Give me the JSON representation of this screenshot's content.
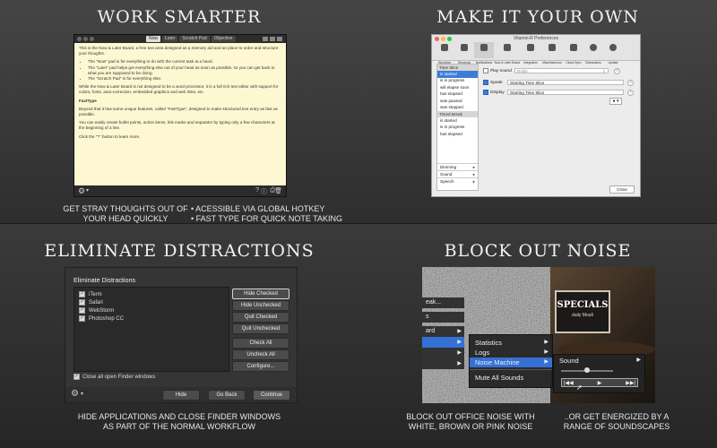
{
  "panels": {
    "work": {
      "heading": "WORK SMARTER",
      "caption_left": [
        "GET STRAY THOUGHTS OUT OF",
        "YOUR HEAD QUICKLY"
      ],
      "caption_right": [
        "• ACESSIBLE VIA GLOBAL HOTKEY",
        "• FAST TYPE FOR QUICK NOTE TAKING"
      ],
      "window": {
        "tabs": [
          "Now",
          "Later",
          "Scratch Pad",
          "Objective"
        ],
        "active_tab": "Now",
        "body": {
          "intro": "This is the Now & Later Board, a free text area designed as a memory aid and an place to order and structure your thoughts.",
          "bullets": [
            "The \"Now\" pad is for everything to do with the current task at a hand.",
            "The \"Later\" pad helps get everything else out of your head as soon as possible, so you can get back to what you are supposed to be doing.",
            "The \"Scratch Pad\" is for everything else."
          ],
          "para2": "While the Now & Later Board is not designed to be a word processor, it is a full rich text editor with support for colors, fonts, auto-correction, embedded graphics and web links, etc.",
          "heading2": "FastType",
          "para3": "Beyond that it has some unique features, called \"FastType\", designed to make structured text entry as fast as possible.",
          "para4": "You can easily create bullet points, action items, link marks and separator by typing only a few characters at the beginning of a line.",
          "para5": "Click the \"?\" button to learn more."
        }
      }
    },
    "own": {
      "heading": "MAKE IT YOUR OWN",
      "window": {
        "title": "Vitamin-R Preferences",
        "toolbar": [
          "Workflow",
          "Shortcuts",
          "Notifications",
          "Now & Later Board",
          "Integration",
          "Miscellaneous",
          "Cloud Sync",
          "Distractions",
          "Update"
        ],
        "selected_tool": "Notifications",
        "groups": [
          {
            "title": "Time Slice",
            "items": [
              "is started",
              "is in progress",
              "will elapse soon",
              "has elapsed",
              "was paused",
              "was stopped"
            ]
          },
          {
            "title": "Timed Break",
            "items": [
              "is started",
              "is in progress",
              "has elapsed"
            ]
          }
        ],
        "selected_item": "is started",
        "categories": [
          "Dimming",
          "Sound",
          "Speech"
        ],
        "play_sound_label": "Play sound",
        "play_sound_value": "Bottle",
        "speak_label": "Speak",
        "speak_value": "Starting Time Slice",
        "display_label": "Display",
        "display_value": "Starting Time Slice",
        "help": "?",
        "close_button": "Close"
      }
    },
    "distractions": {
      "heading": "ELIMINATE DISTRACTIONS",
      "caption": [
        "HIDE APPLICATIONS AND CLOSE FINDER WINDOWS",
        "AS PART OF THE NORMAL WORKFLOW"
      ],
      "window": {
        "title": "Eliminate Distractions",
        "apps": [
          "iTerm",
          "Safari",
          "WebStorm",
          "Photoshop CC"
        ],
        "buttons": [
          "Hide Checked",
          "Hide Unchecked",
          "Quit Checked",
          "Quit Unchecked",
          "Check All",
          "Uncheck All",
          "Configure..."
        ],
        "close_finder_label": "Close all open Finder windows",
        "footer_buttons": [
          "Hide",
          "Go Back",
          "Continue"
        ]
      }
    },
    "noise": {
      "heading": "BLOCK OUT NOISE",
      "caption_left": [
        "BLOCK OUT OFFICE NOISE WITH",
        "WHITE, BROWN OR PINK NOISE"
      ],
      "caption_right": [
        "..OR GET ENERGIZED BY A",
        "RANGE OF SOUNDSCAPES"
      ],
      "left_menu": [
        "eak...",
        "s",
        "ard"
      ],
      "submenu": [
        "Statistics",
        "Logs",
        "Noise Machine",
        "Mute All Sounds"
      ],
      "selected_submenu": "Noise Machine",
      "sound_label": "Sound",
      "volume_level": 0.5,
      "sign_text": "SPECIALS",
      "sign_sub": "daily Moult"
    }
  }
}
